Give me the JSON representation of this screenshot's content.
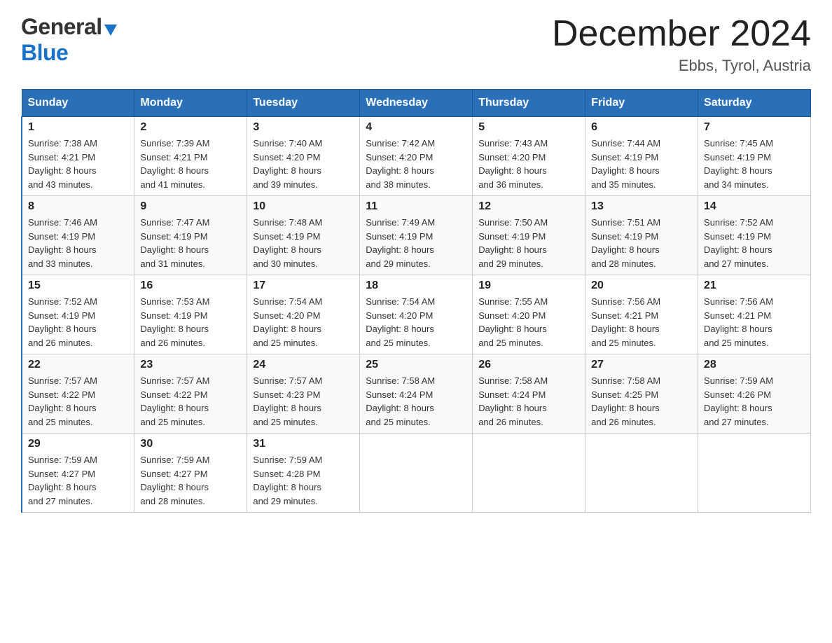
{
  "header": {
    "logo_line1": "General",
    "logo_line2": "Blue",
    "month_title": "December 2024",
    "location": "Ebbs, Tyrol, Austria"
  },
  "weekdays": [
    "Sunday",
    "Monday",
    "Tuesday",
    "Wednesday",
    "Thursday",
    "Friday",
    "Saturday"
  ],
  "weeks": [
    [
      {
        "day": "1",
        "sunrise": "Sunrise: 7:38 AM",
        "sunset": "Sunset: 4:21 PM",
        "daylight": "Daylight: 8 hours",
        "daylight2": "and 43 minutes."
      },
      {
        "day": "2",
        "sunrise": "Sunrise: 7:39 AM",
        "sunset": "Sunset: 4:21 PM",
        "daylight": "Daylight: 8 hours",
        "daylight2": "and 41 minutes."
      },
      {
        "day": "3",
        "sunrise": "Sunrise: 7:40 AM",
        "sunset": "Sunset: 4:20 PM",
        "daylight": "Daylight: 8 hours",
        "daylight2": "and 39 minutes."
      },
      {
        "day": "4",
        "sunrise": "Sunrise: 7:42 AM",
        "sunset": "Sunset: 4:20 PM",
        "daylight": "Daylight: 8 hours",
        "daylight2": "and 38 minutes."
      },
      {
        "day": "5",
        "sunrise": "Sunrise: 7:43 AM",
        "sunset": "Sunset: 4:20 PM",
        "daylight": "Daylight: 8 hours",
        "daylight2": "and 36 minutes."
      },
      {
        "day": "6",
        "sunrise": "Sunrise: 7:44 AM",
        "sunset": "Sunset: 4:19 PM",
        "daylight": "Daylight: 8 hours",
        "daylight2": "and 35 minutes."
      },
      {
        "day": "7",
        "sunrise": "Sunrise: 7:45 AM",
        "sunset": "Sunset: 4:19 PM",
        "daylight": "Daylight: 8 hours",
        "daylight2": "and 34 minutes."
      }
    ],
    [
      {
        "day": "8",
        "sunrise": "Sunrise: 7:46 AM",
        "sunset": "Sunset: 4:19 PM",
        "daylight": "Daylight: 8 hours",
        "daylight2": "and 33 minutes."
      },
      {
        "day": "9",
        "sunrise": "Sunrise: 7:47 AM",
        "sunset": "Sunset: 4:19 PM",
        "daylight": "Daylight: 8 hours",
        "daylight2": "and 31 minutes."
      },
      {
        "day": "10",
        "sunrise": "Sunrise: 7:48 AM",
        "sunset": "Sunset: 4:19 PM",
        "daylight": "Daylight: 8 hours",
        "daylight2": "and 30 minutes."
      },
      {
        "day": "11",
        "sunrise": "Sunrise: 7:49 AM",
        "sunset": "Sunset: 4:19 PM",
        "daylight": "Daylight: 8 hours",
        "daylight2": "and 29 minutes."
      },
      {
        "day": "12",
        "sunrise": "Sunrise: 7:50 AM",
        "sunset": "Sunset: 4:19 PM",
        "daylight": "Daylight: 8 hours",
        "daylight2": "and 29 minutes."
      },
      {
        "day": "13",
        "sunrise": "Sunrise: 7:51 AM",
        "sunset": "Sunset: 4:19 PM",
        "daylight": "Daylight: 8 hours",
        "daylight2": "and 28 minutes."
      },
      {
        "day": "14",
        "sunrise": "Sunrise: 7:52 AM",
        "sunset": "Sunset: 4:19 PM",
        "daylight": "Daylight: 8 hours",
        "daylight2": "and 27 minutes."
      }
    ],
    [
      {
        "day": "15",
        "sunrise": "Sunrise: 7:52 AM",
        "sunset": "Sunset: 4:19 PM",
        "daylight": "Daylight: 8 hours",
        "daylight2": "and 26 minutes."
      },
      {
        "day": "16",
        "sunrise": "Sunrise: 7:53 AM",
        "sunset": "Sunset: 4:19 PM",
        "daylight": "Daylight: 8 hours",
        "daylight2": "and 26 minutes."
      },
      {
        "day": "17",
        "sunrise": "Sunrise: 7:54 AM",
        "sunset": "Sunset: 4:20 PM",
        "daylight": "Daylight: 8 hours",
        "daylight2": "and 25 minutes."
      },
      {
        "day": "18",
        "sunrise": "Sunrise: 7:54 AM",
        "sunset": "Sunset: 4:20 PM",
        "daylight": "Daylight: 8 hours",
        "daylight2": "and 25 minutes."
      },
      {
        "day": "19",
        "sunrise": "Sunrise: 7:55 AM",
        "sunset": "Sunset: 4:20 PM",
        "daylight": "Daylight: 8 hours",
        "daylight2": "and 25 minutes."
      },
      {
        "day": "20",
        "sunrise": "Sunrise: 7:56 AM",
        "sunset": "Sunset: 4:21 PM",
        "daylight": "Daylight: 8 hours",
        "daylight2": "and 25 minutes."
      },
      {
        "day": "21",
        "sunrise": "Sunrise: 7:56 AM",
        "sunset": "Sunset: 4:21 PM",
        "daylight": "Daylight: 8 hours",
        "daylight2": "and 25 minutes."
      }
    ],
    [
      {
        "day": "22",
        "sunrise": "Sunrise: 7:57 AM",
        "sunset": "Sunset: 4:22 PM",
        "daylight": "Daylight: 8 hours",
        "daylight2": "and 25 minutes."
      },
      {
        "day": "23",
        "sunrise": "Sunrise: 7:57 AM",
        "sunset": "Sunset: 4:22 PM",
        "daylight": "Daylight: 8 hours",
        "daylight2": "and 25 minutes."
      },
      {
        "day": "24",
        "sunrise": "Sunrise: 7:57 AM",
        "sunset": "Sunset: 4:23 PM",
        "daylight": "Daylight: 8 hours",
        "daylight2": "and 25 minutes."
      },
      {
        "day": "25",
        "sunrise": "Sunrise: 7:58 AM",
        "sunset": "Sunset: 4:24 PM",
        "daylight": "Daylight: 8 hours",
        "daylight2": "and 25 minutes."
      },
      {
        "day": "26",
        "sunrise": "Sunrise: 7:58 AM",
        "sunset": "Sunset: 4:24 PM",
        "daylight": "Daylight: 8 hours",
        "daylight2": "and 26 minutes."
      },
      {
        "day": "27",
        "sunrise": "Sunrise: 7:58 AM",
        "sunset": "Sunset: 4:25 PM",
        "daylight": "Daylight: 8 hours",
        "daylight2": "and 26 minutes."
      },
      {
        "day": "28",
        "sunrise": "Sunrise: 7:59 AM",
        "sunset": "Sunset: 4:26 PM",
        "daylight": "Daylight: 8 hours",
        "daylight2": "and 27 minutes."
      }
    ],
    [
      {
        "day": "29",
        "sunrise": "Sunrise: 7:59 AM",
        "sunset": "Sunset: 4:27 PM",
        "daylight": "Daylight: 8 hours",
        "daylight2": "and 27 minutes."
      },
      {
        "day": "30",
        "sunrise": "Sunrise: 7:59 AM",
        "sunset": "Sunset: 4:27 PM",
        "daylight": "Daylight: 8 hours",
        "daylight2": "and 28 minutes."
      },
      {
        "day": "31",
        "sunrise": "Sunrise: 7:59 AM",
        "sunset": "Sunset: 4:28 PM",
        "daylight": "Daylight: 8 hours",
        "daylight2": "and 29 minutes."
      },
      null,
      null,
      null,
      null
    ]
  ]
}
